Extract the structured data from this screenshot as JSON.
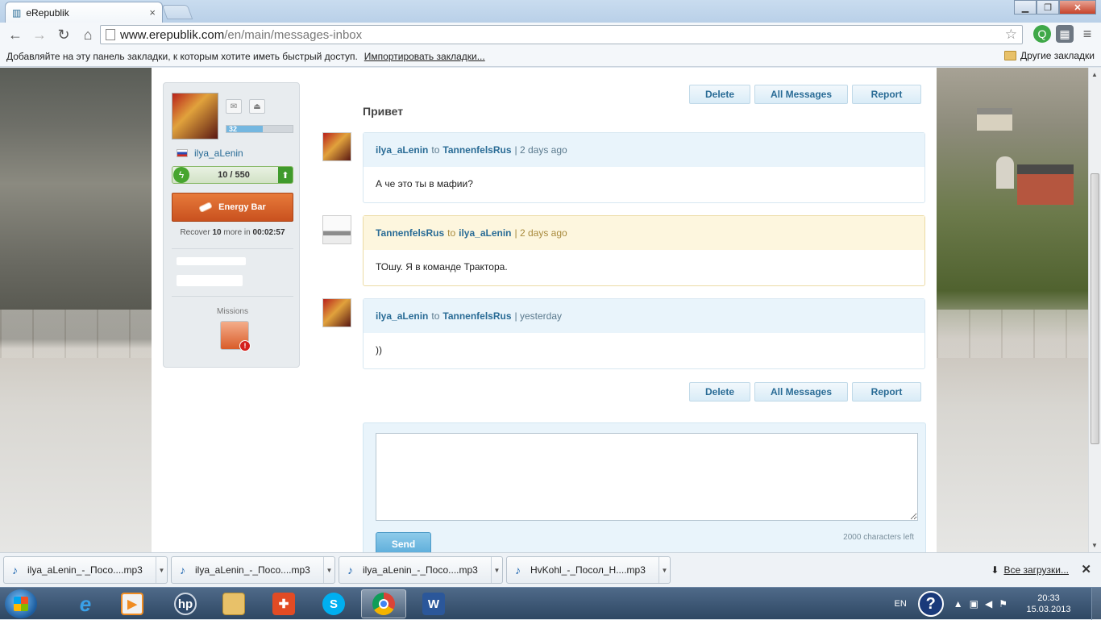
{
  "browser": {
    "tab_title": "eRepublik",
    "tab_close": "×",
    "url_host": "www.erepublik.com",
    "url_path": "/en/main/messages-inbox",
    "bookmarks_prompt": "Добавляйте на эту панель закладки, к которым хотите иметь быстрый доступ.",
    "bookmarks_import": "Импортировать закладки...",
    "bookmarks_other": "Другие закладки"
  },
  "sidebar": {
    "level": "32",
    "level_progress_pct": 55,
    "citizen_name": "ilya_aLenin",
    "energy": "10 / 550",
    "energy_button": "Energy Bar",
    "recover_prefix": "Recover",
    "recover_amount": "10",
    "recover_mid": "more in",
    "recover_time": "00:02:57",
    "missions_label": "Missions",
    "mission_alert": "!"
  },
  "actions": {
    "delete": "Delete",
    "all_messages": "All Messages",
    "report": "Report"
  },
  "thread": {
    "subject": "Привет",
    "messages": [
      {
        "from": "ilya_aLenin",
        "to_word": "to",
        "to": "TannenfelsRus",
        "time": "| 2 days ago",
        "body": "А че это ты в мафии?"
      },
      {
        "from": "TannenfelsRus",
        "to_word": "to",
        "to": "ilya_aLenin",
        "time": "| 2 days ago",
        "body": "ТОшу. Я в команде Трактора."
      },
      {
        "from": "ilya_aLenin",
        "to_word": "to",
        "to": "TannenfelsRus",
        "time": "| yesterday",
        "body": "))"
      }
    ]
  },
  "reply": {
    "send": "Send",
    "chars_left": "2000 characters left"
  },
  "downloads": {
    "items": [
      "ilya_aLenin_-_Посо....mp3",
      "ilya_aLenin_-_Посо....mp3",
      "ilya_aLenin_-_Посо....mp3",
      "HvKohl_-_Посол_Н....mp3"
    ],
    "all_downloads": "Все загрузки...",
    "close": "✕"
  },
  "taskbar": {
    "lang": "EN",
    "time": "20:33",
    "date": "15.03.2013"
  }
}
